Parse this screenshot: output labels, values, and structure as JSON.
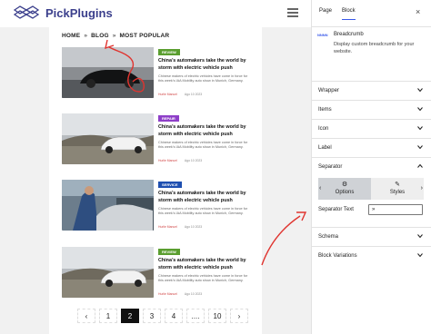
{
  "header": {
    "logo_text": "PickPlugins"
  },
  "breadcrumb": {
    "items": [
      "HOME",
      "BLOG",
      "MOST POPULAR"
    ],
    "separator": "»"
  },
  "posts": [
    {
      "badge": "REVIEW",
      "badge_color": "#5a9e2f",
      "title": "China’s automakers take the world by storm with electric vehicle push",
      "excerpt": "Chinese makers of electric vehicles have come in force for this week’s IAA Mobility auto show in Munich, Germany.",
      "author": "Hurlie Manuel",
      "date": "Ago 10 2023"
    },
    {
      "badge": "REPAIR",
      "badge_color": "#8e3fc8",
      "title": "China’s automakers take the world by storm with electric vehicle push",
      "excerpt": "Chinese makers of electric vehicles have come in force for this week’s IAA Mobility auto show in Munich, Germany.",
      "author": "Hurlie Manuel",
      "date": "Ago 10 2023"
    },
    {
      "badge": "SERVICE",
      "badge_color": "#1e4fb0",
      "title": "China’s automakers take the world by storm with electric vehicle push",
      "excerpt": "Chinese makers of electric vehicles have come in force for this week’s IAA Mobility auto show in Munich, Germany.",
      "author": "Hurlie Manuel",
      "date": "Ago 10 2023"
    },
    {
      "badge": "REVIEW",
      "badge_color": "#5a9e2f",
      "title": "China’s automakers take the world by storm with electric vehicle push",
      "excerpt": "Chinese makers of electric vehicles have come in force for this week’s IAA Mobility auto show in Munich, Germany.",
      "author": "Hurlie Manuel",
      "date": "Ago 10 2023"
    }
  ],
  "pagination": {
    "prev": "‹",
    "next": "›",
    "pages": [
      "1",
      "2",
      "3",
      "4",
      "....",
      "10"
    ],
    "active": "2"
  },
  "sidebar": {
    "tabs": [
      "Page",
      "Block"
    ],
    "active_tab": "Block",
    "close": "×",
    "block": {
      "icon_text": "NNNN",
      "name": "Breadcrumb",
      "description": "Display custom breadcrumb for your website."
    },
    "panels": [
      "Wrapper",
      "Items",
      "Icon",
      "Label",
      "Separator",
      "Schema",
      "Block Variations"
    ],
    "separator": {
      "tabs": [
        "Options",
        "Styles"
      ],
      "active_tab": "Options",
      "text_label": "Separator Text",
      "text_value": "»"
    }
  },
  "colors": {
    "accent": "#3858e9",
    "annotation": "#e0342f",
    "brand": "#3b3f8c"
  }
}
